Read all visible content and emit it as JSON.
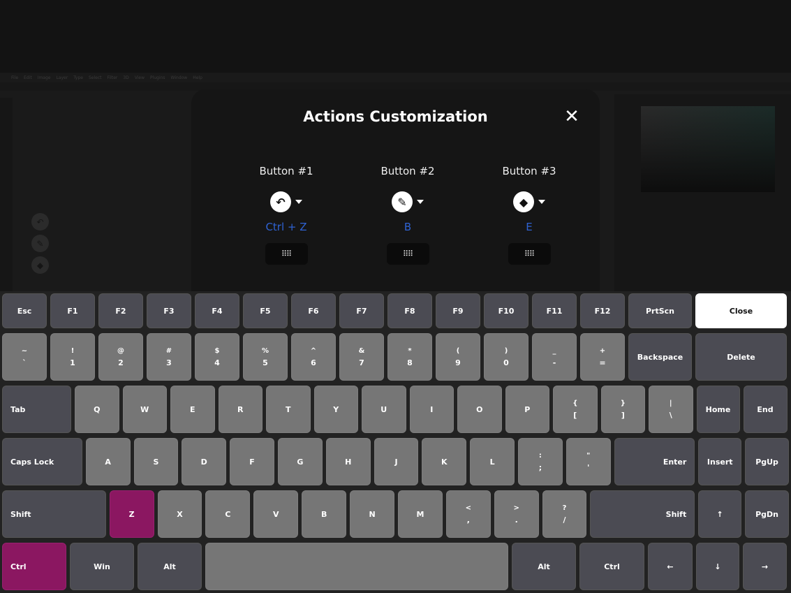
{
  "background_app": {
    "menu": [
      "File",
      "Edit",
      "Image",
      "Layer",
      "Type",
      "Select",
      "Filter",
      "3D",
      "View",
      "Plugins",
      "Window",
      "Help"
    ],
    "float_icons": [
      "undo-icon",
      "brush-icon",
      "eraser-icon"
    ]
  },
  "modal": {
    "title": "Actions Customization",
    "close_icon": "close-icon",
    "buttons": [
      {
        "label": "Button #1",
        "icon": "undo-icon",
        "glyph": "↶",
        "shortcut": "Ctrl + Z"
      },
      {
        "label": "Button #2",
        "icon": "brush-icon",
        "glyph": "🖌",
        "shortcut": "B"
      },
      {
        "label": "Button #3",
        "icon": "eraser-icon",
        "glyph": "◆",
        "shortcut": "E"
      }
    ],
    "keyboard_button_glyph": "⠿⠿"
  },
  "colors": {
    "accent_blue": "#2f63d4",
    "active_key": "#8b1761",
    "light_key": "#767676",
    "dark_key": "#4b4b53"
  },
  "keyboard": {
    "rows": [
      [
        {
          "l": "Esc",
          "t": "dark"
        },
        {
          "l": "F1",
          "t": "dark"
        },
        {
          "l": "F2",
          "t": "dark"
        },
        {
          "l": "F3",
          "t": "dark"
        },
        {
          "l": "F4",
          "t": "dark"
        },
        {
          "l": "F5",
          "t": "dark"
        },
        {
          "l": "F6",
          "t": "dark"
        },
        {
          "l": "F7",
          "t": "dark"
        },
        {
          "l": "F8",
          "t": "dark"
        },
        {
          "l": "F9",
          "t": "dark"
        },
        {
          "l": "F10",
          "t": "dark"
        },
        {
          "l": "F11",
          "t": "dark"
        },
        {
          "l": "F12",
          "t": "dark"
        },
        {
          "l": "PrtScn",
          "t": "dark"
        },
        {
          "l": "Close",
          "t": "white"
        }
      ],
      [
        {
          "s": "~",
          "l": "`"
        },
        {
          "s": "!",
          "l": "1"
        },
        {
          "s": "@",
          "l": "2"
        },
        {
          "s": "#",
          "l": "3"
        },
        {
          "s": "$",
          "l": "4"
        },
        {
          "s": "%",
          "l": "5"
        },
        {
          "s": "^",
          "l": "6"
        },
        {
          "s": "&",
          "l": "7"
        },
        {
          "s": "*",
          "l": "8"
        },
        {
          "s": "(",
          "l": "9"
        },
        {
          "s": ")",
          "l": "0"
        },
        {
          "s": "_",
          "l": "-"
        },
        {
          "s": "+",
          "l": "="
        },
        {
          "l": "Backspace",
          "t": "dark"
        },
        {
          "l": "Delete",
          "t": "dark"
        }
      ],
      [
        {
          "l": "Tab",
          "t": "dark",
          "a": "left"
        },
        {
          "l": "Q"
        },
        {
          "l": "W"
        },
        {
          "l": "E"
        },
        {
          "l": "R"
        },
        {
          "l": "T"
        },
        {
          "l": "Y"
        },
        {
          "l": "U"
        },
        {
          "l": "I"
        },
        {
          "l": "O"
        },
        {
          "l": "P"
        },
        {
          "s": "{",
          "l": "["
        },
        {
          "s": "}",
          "l": "]"
        },
        {
          "s": "|",
          "l": "\\"
        },
        {
          "l": "Home",
          "t": "dark"
        },
        {
          "l": "End",
          "t": "dark"
        }
      ],
      [
        {
          "l": "Caps Lock",
          "t": "dark",
          "a": "left"
        },
        {
          "l": "A"
        },
        {
          "l": "S"
        },
        {
          "l": "D"
        },
        {
          "l": "F"
        },
        {
          "l": "G"
        },
        {
          "l": "H"
        },
        {
          "l": "J"
        },
        {
          "l": "K"
        },
        {
          "l": "L"
        },
        {
          "s": ":",
          "l": ";"
        },
        {
          "s": "\"",
          "l": "'"
        },
        {
          "l": "Enter",
          "t": "dark",
          "a": "right"
        },
        {
          "l": "Insert",
          "t": "dark"
        },
        {
          "l": "PgUp",
          "t": "dark"
        }
      ],
      [
        {
          "l": "Shift",
          "t": "dark",
          "a": "left"
        },
        {
          "l": "Z",
          "t": "mag"
        },
        {
          "l": "X"
        },
        {
          "l": "C"
        },
        {
          "l": "V"
        },
        {
          "l": "B"
        },
        {
          "l": "N"
        },
        {
          "l": "M"
        },
        {
          "s": "<",
          "l": ","
        },
        {
          "s": ">",
          "l": "."
        },
        {
          "s": "?",
          "l": "/"
        },
        {
          "l": "Shift",
          "t": "dark",
          "a": "right"
        },
        {
          "l": "↑",
          "t": "dark"
        },
        {
          "l": "PgDn",
          "t": "dark"
        }
      ],
      [
        {
          "l": "Ctrl",
          "t": "mag",
          "a": "left"
        },
        {
          "l": "Win",
          "t": "dark"
        },
        {
          "l": "Alt",
          "t": "dark"
        },
        {
          "l": ""
        },
        {
          "l": "Alt",
          "t": "dark"
        },
        {
          "l": "Ctrl",
          "t": "dark"
        },
        {
          "l": "←",
          "t": "dark"
        },
        {
          "l": "↓",
          "t": "dark"
        },
        {
          "l": "→",
          "t": "dark"
        }
      ]
    ]
  }
}
